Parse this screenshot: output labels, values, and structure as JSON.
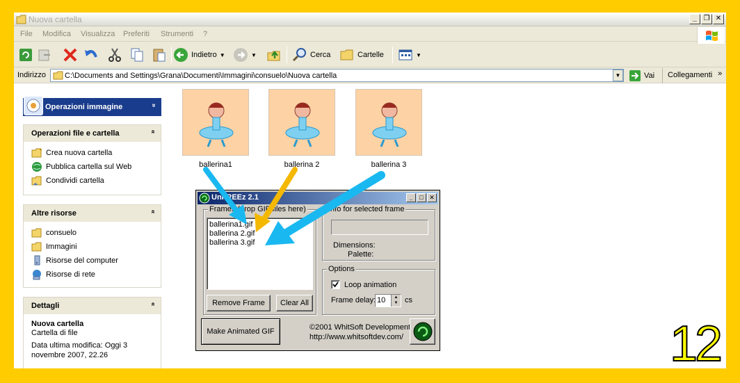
{
  "window": {
    "title": "Nuova cartella",
    "minimize": "_",
    "maximize": "❐",
    "close": "✕"
  },
  "menu": [
    "File",
    "Modifica",
    "Visualizza",
    "Preferiti",
    "Strumenti",
    "?"
  ],
  "toolbar": {
    "back_label": "Indietro",
    "search_label": "Cerca",
    "folders_label": "Cartelle"
  },
  "address": {
    "label": "Indirizzo",
    "path": "C:\\Documents and Settings\\Grana\\Documenti\\Immagini\\consuelo\\Nuova cartella",
    "go_label": "Vai",
    "links_label": "Collegamenti",
    "links_chevron": "»"
  },
  "left_pane": {
    "image_tasks": {
      "title": "Operazioni immagine",
      "chevron": "»"
    },
    "file_tasks": {
      "title": "Operazioni file e cartella",
      "chevron": "«",
      "items": [
        "Crea nuova cartella",
        "Pubblica cartella sul Web",
        "Condividi cartella"
      ]
    },
    "other_places": {
      "title": "Altre risorse",
      "chevron": "«",
      "items": [
        "consuelo",
        "Immagini",
        "Risorse del computer",
        "Risorse di rete"
      ]
    },
    "details": {
      "title": "Dettagli",
      "chevron": "«",
      "name": "Nuova cartella",
      "type": "Cartella di file",
      "modified_1": "Data ultima modifica: Oggi 3",
      "modified_2": "novembre 2007, 22.26"
    }
  },
  "files": [
    "ballerina1",
    "ballerina 2",
    "ballerina 3"
  ],
  "dialog": {
    "title": "UnFREEz 2.1",
    "minimize": "_",
    "maximize": "□",
    "close": "✕",
    "frames_legend": "Frames (drop GIF files here)",
    "frames": [
      "ballerina1.gif",
      "ballerina 2.gif",
      "ballerina 3.gif"
    ],
    "remove_frame": "Remove Frame",
    "clear_all": "Clear All",
    "info_legend": "Info for selected frame",
    "dimensions_label": "Dimensions:",
    "palette_label": "Palette:",
    "options_legend": "Options",
    "loop_label": "Loop animation",
    "loop_checked": true,
    "delay_label": "Frame delay:",
    "delay_value": "10",
    "delay_unit": "cs",
    "make_gif": "Make Animated GIF",
    "copyright": "©2001 WhitSoft Development",
    "url": "http://www.whitsoftdev.com/"
  },
  "step_number": "12",
  "colors": {
    "frame_bg": "#FFCC00",
    "arrow_blue": "#1ab8f0",
    "arrow_orange": "#f5b800"
  }
}
